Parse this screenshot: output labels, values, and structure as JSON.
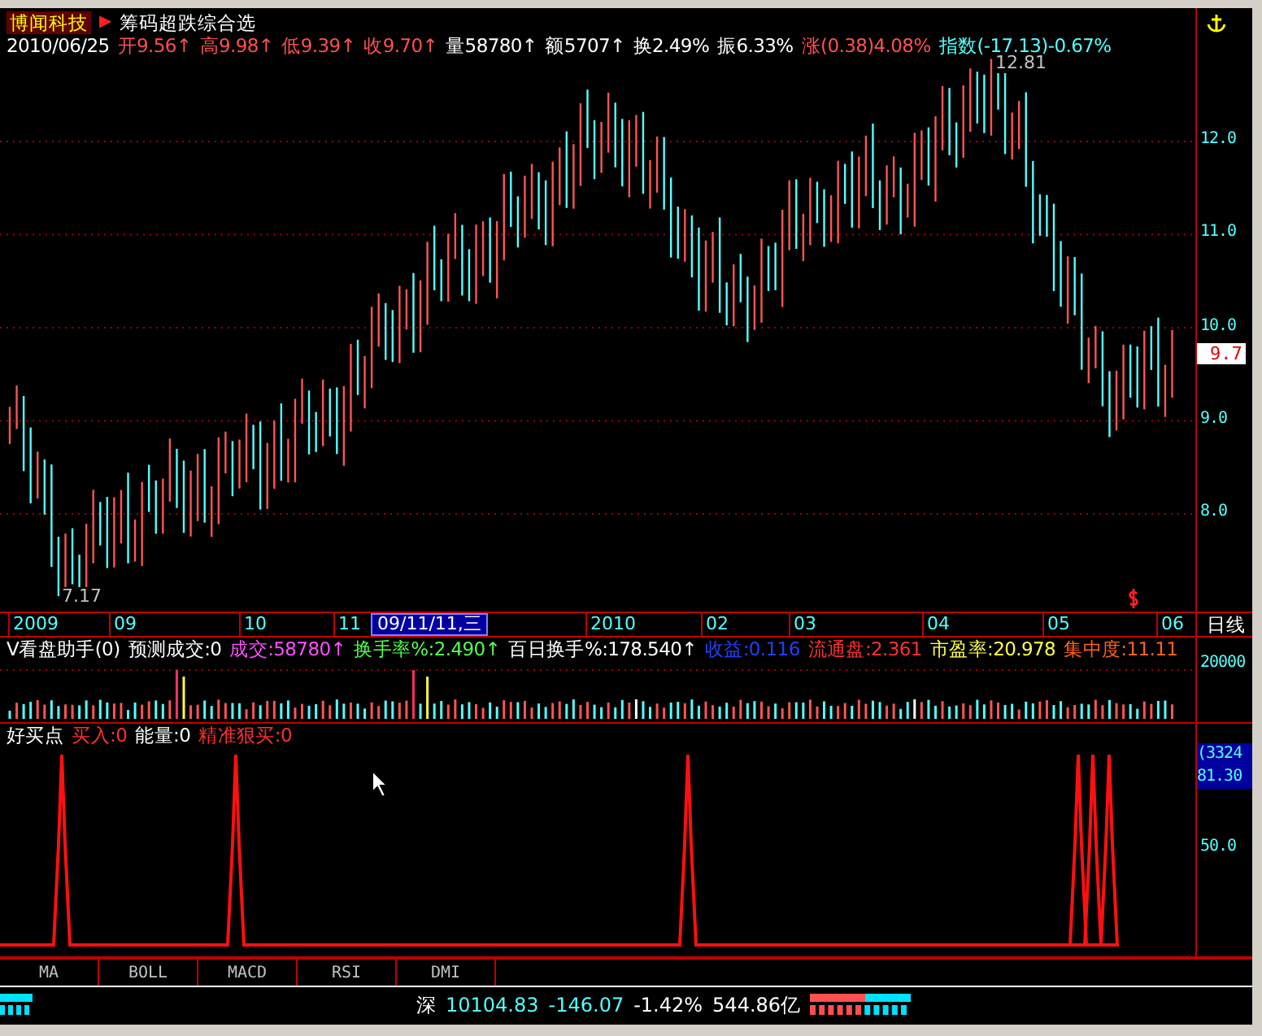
{
  "stock": {
    "name": "博闻科技",
    "arrow": "▶",
    "formula": "筹码超跌综合选"
  },
  "quote": [
    {
      "text": "2010/06/25",
      "color": "#ffffff"
    },
    {
      "text": "开9.56↑",
      "color": "#ff5050"
    },
    {
      "text": "高9.98↑",
      "color": "#ff5050"
    },
    {
      "text": "低9.39↑",
      "color": "#ff5050"
    },
    {
      "text": "收9.70↑",
      "color": "#ff5050"
    },
    {
      "text": "量58780↑",
      "color": "#ffffff"
    },
    {
      "text": "额5707↑",
      "color": "#ffffff"
    },
    {
      "text": "换2.49%",
      "color": "#ffffff"
    },
    {
      "text": "振6.33%",
      "color": "#ffffff"
    },
    {
      "text": "涨(0.38)4.08%",
      "color": "#ff5050"
    },
    {
      "text": "指数(-17.13)-0.67%",
      "color": "#54ffff"
    }
  ],
  "price_axis": {
    "ticks": [
      "12.0",
      "11.0",
      "10.0",
      "9.0",
      "8.0"
    ],
    "current": "9.7",
    "high_label": "12.81",
    "low_label": "7.17"
  },
  "date_axis": {
    "labels": [
      {
        "text": "2009",
        "selected": false
      },
      {
        "text": "09",
        "selected": false
      },
      {
        "text": "10",
        "selected": false
      },
      {
        "text": "11",
        "selected": false
      },
      {
        "text": "09/11/11,三",
        "selected": true
      },
      {
        "text": "2010",
        "selected": false
      },
      {
        "text": "02",
        "selected": false
      },
      {
        "text": "03",
        "selected": false
      },
      {
        "text": "04",
        "selected": false
      },
      {
        "text": "05",
        "selected": false
      },
      {
        "text": "06",
        "selected": false
      }
    ],
    "period": "日线"
  },
  "volume_panel": {
    "items": [
      {
        "text": "V看盘助手(0)",
        "color": "#ffffff"
      },
      {
        "text": "预测成交:0",
        "color": "#ffffff"
      },
      {
        "text": "成交:58780↑",
        "color": "#ff50ff"
      },
      {
        "text": "换手率%:2.490↑",
        "color": "#50ff50"
      },
      {
        "text": "百日换手%:178.540↑",
        "color": "#ffffff"
      },
      {
        "text": "收益:0.116",
        "color": "#2040ff"
      },
      {
        "text": "流通盘:2.361",
        "color": "#ff3030"
      },
      {
        "text": "市盈率:20.978",
        "color": "#ffff50"
      },
      {
        "text": "集中度:11.11",
        "color": "#ff6020"
      }
    ],
    "axis_tick": "20000"
  },
  "indicator_panel": {
    "items": [
      {
        "text": "好买点",
        "color": "#ffffff"
      },
      {
        "text": "买入:0",
        "color": "#ff3030"
      },
      {
        "text": "能量:0",
        "color": "#ffffff"
      },
      {
        "text": "精准狠买:0",
        "color": "#ff3030"
      }
    ],
    "axis_labels": [
      "(3324",
      "81.30"
    ],
    "axis_tick": "50.0"
  },
  "tabs": [
    {
      "label": "MA",
      "selected": false
    },
    {
      "label": "BOLL",
      "selected": false
    },
    {
      "label": "MACD",
      "selected": false
    },
    {
      "label": "RSI",
      "selected": false
    },
    {
      "label": "DMI",
      "selected": false
    }
  ],
  "status_bar": {
    "market": "深",
    "index": "10104.83",
    "change": "-146.07",
    "percent": "-1.42%",
    "turnover": "544.86亿"
  }
}
